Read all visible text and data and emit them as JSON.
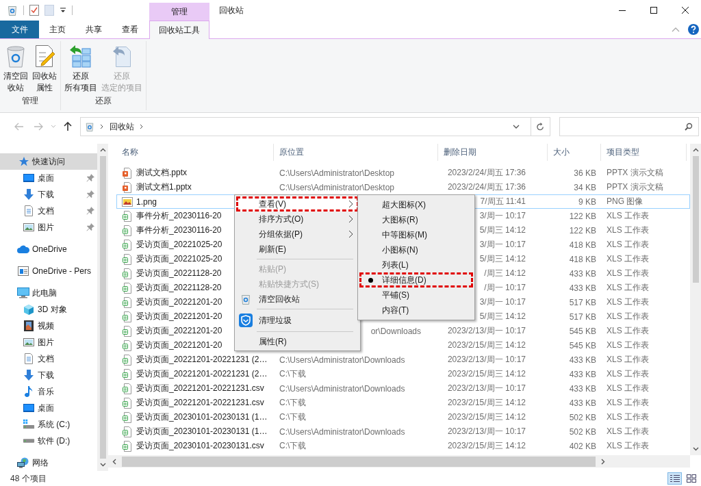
{
  "window": {
    "title": "回收站",
    "context_group": "管理"
  },
  "ribbon_tabs": [
    {
      "label": "文件",
      "kind": "file",
      "selected": false
    },
    {
      "label": "主页",
      "kind": "tab",
      "selected": false
    },
    {
      "label": "共享",
      "kind": "tab",
      "selected": false
    },
    {
      "label": "查看",
      "kind": "tab",
      "selected": false
    },
    {
      "label": "回收站工具",
      "kind": "tab",
      "selected": true
    }
  ],
  "ribbon_groups": [
    {
      "label": "管理",
      "buttons": [
        {
          "lines": [
            "清空回",
            "收站"
          ],
          "kind": "empty-bin",
          "disabled": false
        },
        {
          "lines": [
            "回收站",
            "属性"
          ],
          "kind": "properties",
          "disabled": false
        }
      ]
    },
    {
      "label": "还原",
      "buttons": [
        {
          "lines": [
            "还原",
            "所有项目"
          ],
          "kind": "restore-all",
          "disabled": false
        },
        {
          "lines": [
            "还原",
            "选定的项目"
          ],
          "kind": "restore-selected",
          "disabled": true
        }
      ]
    }
  ],
  "address": {
    "crumbs": [
      "回收站"
    ]
  },
  "nav": [
    {
      "label": "快速访问",
      "kind": "star",
      "selected": true,
      "children": [
        {
          "label": "桌面",
          "kind": "desktop",
          "pinned": true,
          "selected": false
        },
        {
          "label": "下载",
          "kind": "download",
          "pinned": true,
          "selected": false
        },
        {
          "label": "文档",
          "kind": "document",
          "pinned": true,
          "selected": false
        },
        {
          "label": "图片",
          "kind": "pictures",
          "pinned": true,
          "selected": false
        }
      ]
    },
    {
      "label": "OneDrive",
      "kind": "cloud",
      "selected": false
    },
    {
      "label": "OneDrive - Pers",
      "kind": "cloud-folder",
      "selected": false
    },
    {
      "label": "此电脑",
      "kind": "computer",
      "selected": false,
      "children": [
        {
          "label": "3D 对象",
          "kind": "cube",
          "selected": false
        },
        {
          "label": "视频",
          "kind": "film",
          "selected": false
        },
        {
          "label": "图片",
          "kind": "pictures",
          "selected": false
        },
        {
          "label": "文档",
          "kind": "document",
          "selected": false
        },
        {
          "label": "下载",
          "kind": "download",
          "selected": false
        },
        {
          "label": "音乐",
          "kind": "music",
          "selected": false
        },
        {
          "label": "桌面",
          "kind": "desktop",
          "selected": false
        },
        {
          "label": "系统 (C:)",
          "kind": "system-drive",
          "selected": false
        },
        {
          "label": "软件 (D:)",
          "kind": "drive",
          "selected": false
        }
      ]
    },
    {
      "label": "网络",
      "kind": "network",
      "selected": false
    }
  ],
  "table": {
    "columns": [
      "名称",
      "原位置",
      "删除日期",
      "大小",
      "项目类型"
    ],
    "rows": [
      {
        "name": "测试文档.pptx",
        "kind": "pptx",
        "location": "C:\\Users\\Administrator\\Desktop",
        "location_partial": false,
        "date": "2023/2/24/周五 17:36",
        "size": "36 KB",
        "type": "PPTX 演示文稿",
        "selected": false
      },
      {
        "name": "测试文档1.pptx",
        "kind": "pptx",
        "location": "C:\\Users\\Administrator\\Desktop",
        "location_partial": false,
        "date": "2023/2/24/周五 17:36",
        "size": "34 KB",
        "type": "PPTX 演示文稿",
        "selected": false
      },
      {
        "name": "1.png",
        "kind": "png",
        "date": "7/周五 11:41",
        "size": "9 KB",
        "type": "PNG 图像",
        "selected": true
      },
      {
        "name": "事件分析_20230116-20",
        "kind": "xls",
        "date": "3/周一 10:17",
        "size": "122 KB",
        "type": "XLS 工作表",
        "selected": false
      },
      {
        "name": "事件分析_20230116-20",
        "kind": "xls",
        "date": "5/周三 14:12",
        "size": "122 KB",
        "type": "XLS 工作表",
        "selected": false
      },
      {
        "name": "受访页面_20221025-20",
        "kind": "xls",
        "date": "3/周一 10:17",
        "size": "418 KB",
        "type": "XLS 工作表",
        "selected": false
      },
      {
        "name": "受访页面_20221025-20",
        "kind": "xls",
        "date": "5/周三 14:12",
        "size": "418 KB",
        "type": "XLS 工作表",
        "selected": false
      },
      {
        "name": "受访页面_20221128-20",
        "kind": "xls",
        "date": "/周三 14:12",
        "size": "433 KB",
        "type": "XLS 工作表",
        "selected": false
      },
      {
        "name": "受访页面_20221128-20",
        "kind": "xls",
        "date": "/周一 10:17",
        "size": "433 KB",
        "type": "XLS 工作表",
        "selected": false
      },
      {
        "name": "受访页面_20221201-20",
        "kind": "xls",
        "date": "3/周一 10:17",
        "size": "517 KB",
        "type": "XLS 工作表",
        "selected": false
      },
      {
        "name": "受访页面_20221201-20",
        "kind": "xls",
        "date": "5/周三 14:12",
        "size": "517 KB",
        "type": "XLS 工作表",
        "selected": false
      },
      {
        "name": "受访页面_20221201-20",
        "kind": "xls",
        "location": "or\\Downloads",
        "location_partial": true,
        "date": "2023/2/13/周一 10:17",
        "size": "545 KB",
        "type": "XLS 工作表",
        "selected": false
      },
      {
        "name": "受访页面_20221201-20",
        "kind": "xls",
        "date": "2023/2/15/周三 14:12",
        "size": "545 KB",
        "type": "XLS 工作表",
        "selected": false
      },
      {
        "name": "受访页面_20221201-20221231 (2…",
        "kind": "xls",
        "location": "C:\\Users\\Administrator\\Downloads",
        "location_partial": false,
        "date": "2023/2/13/周一 10:17",
        "size": "433 KB",
        "type": "XLS 工作表",
        "selected": false
      },
      {
        "name": "受访页面_20221201-20221231 (2…",
        "kind": "xls",
        "location": "C:\\下载",
        "location_partial": false,
        "date": "2023/2/15/周三 14:12",
        "size": "433 KB",
        "type": "XLS 工作表",
        "selected": false
      },
      {
        "name": "受访页面_20221201-20221231.csv",
        "kind": "xls",
        "location": "C:\\Users\\Administrator\\Downloads",
        "location_partial": false,
        "date": "2023/2/13/周一 10:17",
        "size": "433 KB",
        "type": "XLS 工作表",
        "selected": false
      },
      {
        "name": "受访页面_20221201-20221231.csv",
        "kind": "xls",
        "location": "C:\\下载",
        "location_partial": false,
        "date": "2023/2/15/周三 14:12",
        "size": "433 KB",
        "type": "XLS 工作表",
        "selected": false
      },
      {
        "name": "受访页面_20230101-20230131 (1…",
        "kind": "xls",
        "location": "C:\\下载",
        "location_partial": false,
        "date": "2023/2/15/周三 14:12",
        "size": "502 KB",
        "type": "XLS 工作表",
        "selected": false
      },
      {
        "name": "受访页面_20230101-20230131 (1…",
        "kind": "xls",
        "location": "C:\\Users\\Administrator\\Downloads",
        "location_partial": false,
        "date": "2023/2/13/周一 10:17",
        "size": "502 KB",
        "type": "XLS 工作表",
        "selected": false
      },
      {
        "name": "受访页面_20230101-20230131.csv",
        "kind": "xls",
        "location": "C:\\下载",
        "location_partial": false,
        "date": "2023/2/15/周三 14:12",
        "size": "402 KB",
        "type": "XLS 工作表",
        "selected": false
      }
    ]
  },
  "context_menu": {
    "items": [
      {
        "label": "查看(V)",
        "kind": "submenu",
        "disabled": false,
        "marked": true
      },
      {
        "label": "排序方式(O)",
        "kind": "submenu",
        "disabled": false,
        "marked": false
      },
      {
        "label": "分组依据(P)",
        "kind": "submenu",
        "disabled": false,
        "marked": false
      },
      {
        "label": "刷新(E)",
        "kind": "command",
        "disabled": false,
        "marked": false
      },
      {
        "kind": "separator"
      },
      {
        "label": "粘贴(P)",
        "kind": "command",
        "disabled": true,
        "marked": false
      },
      {
        "label": "粘贴快捷方式(S)",
        "kind": "command",
        "disabled": true,
        "marked": false
      },
      {
        "label": "清空回收站",
        "kind": "recycle-command",
        "disabled": false,
        "marked": false
      },
      {
        "kind": "separator"
      },
      {
        "label": "清理垃圾",
        "kind": "shield-command",
        "disabled": false,
        "marked": false
      },
      {
        "kind": "separator"
      },
      {
        "label": "属性(R)",
        "kind": "command",
        "disabled": false,
        "marked": false
      }
    ]
  },
  "view_submenu": {
    "items": [
      {
        "label": "超大图标(X)",
        "checked": false,
        "marked": false
      },
      {
        "label": "大图标(R)",
        "checked": false,
        "marked": false
      },
      {
        "label": "中等图标(M)",
        "checked": false,
        "marked": false
      },
      {
        "label": "小图标(N)",
        "checked": false,
        "marked": false
      },
      {
        "label": "列表(L)",
        "checked": false,
        "marked": false
      },
      {
        "label": "详细信息(D)",
        "checked": true,
        "marked": true
      },
      {
        "label": "平铺(S)",
        "checked": false,
        "marked": false
      },
      {
        "label": "内容(T)",
        "checked": false,
        "marked": false
      }
    ]
  },
  "status_bar": {
    "item_count": "48 个项目",
    "view_buttons": [
      {
        "kind": "details",
        "selected": true
      },
      {
        "kind": "large-icons",
        "selected": false
      }
    ]
  }
}
